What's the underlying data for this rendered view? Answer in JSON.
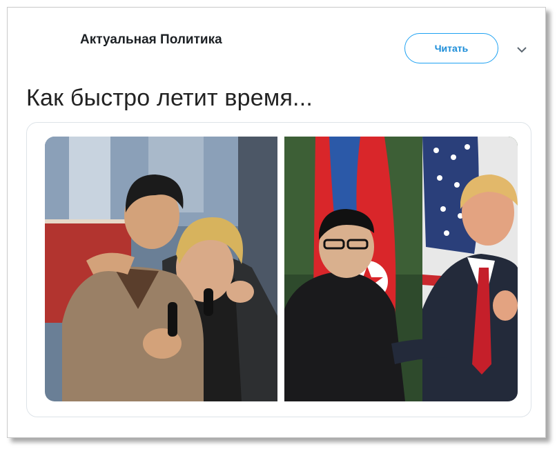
{
  "account": {
    "name": "Актуальная Политика",
    "handle": ""
  },
  "header": {
    "follow_label": "Читать",
    "more_icon": "chevron-down-icon"
  },
  "tweet": {
    "text": "Как быстро летит время..."
  },
  "media": {
    "images": [
      {
        "subject": "two-men-with-microphones-photo"
      },
      {
        "subject": "two-men-with-flags-photo"
      }
    ]
  },
  "colors": {
    "accent": "#1da1f2",
    "text": "#1c2024",
    "border": "#dde3e8"
  }
}
